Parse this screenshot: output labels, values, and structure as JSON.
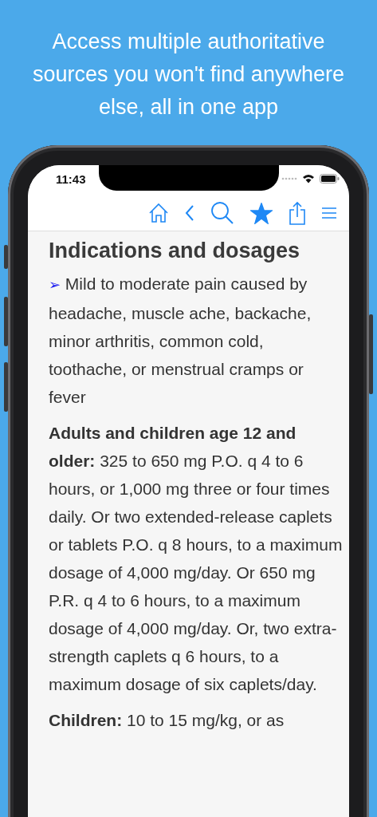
{
  "headline": "Access multiple authoritative sources you won't find anywhere else, all in one app",
  "status_bar": {
    "time": "11:43"
  },
  "toolbar": {
    "bookmarked": true
  },
  "article": {
    "title": "Indications and dosages",
    "bullet": {
      "marker": "➢",
      "text": "Mild to moderate pain caused by headache, muscle ache, backache, minor arthritis, common cold, toothache, or menstrual cramps or fever"
    },
    "paragraphs": [
      {
        "text": "**Adults and children age 12 and older:** 325 to 650 mg P.O. q 4 to 6 hours, or 1,000 mg three or four times daily. Or two extended-release caplets or tablets P.O. q 8 hours, to a maximum dosage of 4,000 mg/day. Or 650 mg P.R. q 4 to 6 hours, to a maximum dosage of 4,000 mg/day. Or, two extra-strength caplets q 6 hours, to a maximum dosage of six caplets/day."
      },
      {
        "text": "**Children:** 10 to 15 mg/kg, or as"
      }
    ]
  }
}
